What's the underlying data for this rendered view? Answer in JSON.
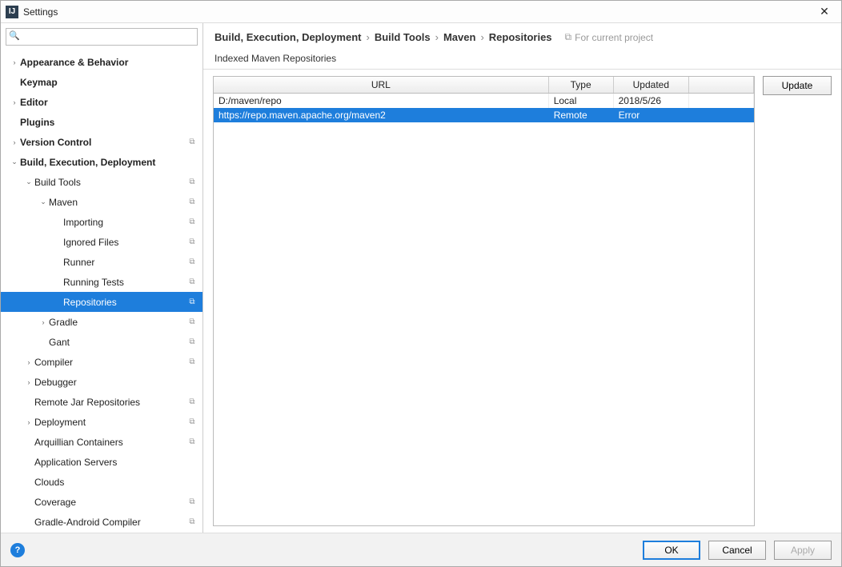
{
  "window": {
    "title": "Settings"
  },
  "breadcrumb": {
    "items": [
      "Build, Execution, Deployment",
      "Build Tools",
      "Maven",
      "Repositories"
    ],
    "hint": "For current project"
  },
  "section_label": "Indexed Maven Repositories",
  "table": {
    "headers": {
      "url": "URL",
      "type": "Type",
      "updated": "Updated",
      "extra": ""
    },
    "rows": [
      {
        "url": "D:/maven/repo",
        "type": "Local",
        "updated": "2018/5/26",
        "selected": false
      },
      {
        "url": "https://repo.maven.apache.org/maven2",
        "type": "Remote",
        "updated": "Error",
        "selected": true
      }
    ]
  },
  "buttons": {
    "update": "Update",
    "ok": "OK",
    "cancel": "Cancel",
    "apply": "Apply"
  },
  "tree": [
    {
      "label": "Appearance & Behavior",
      "indent": 0,
      "arrow": ">",
      "bold": true
    },
    {
      "label": "Keymap",
      "indent": 0,
      "arrow": "",
      "bold": true
    },
    {
      "label": "Editor",
      "indent": 0,
      "arrow": ">",
      "bold": true
    },
    {
      "label": "Plugins",
      "indent": 0,
      "arrow": "",
      "bold": true
    },
    {
      "label": "Version Control",
      "indent": 0,
      "arrow": ">",
      "bold": true,
      "badge": true
    },
    {
      "label": "Build, Execution, Deployment",
      "indent": 0,
      "arrow": "v",
      "bold": true
    },
    {
      "label": "Build Tools",
      "indent": 1,
      "arrow": "v",
      "badge": true
    },
    {
      "label": "Maven",
      "indent": 2,
      "arrow": "v",
      "badge": true
    },
    {
      "label": "Importing",
      "indent": 3,
      "arrow": "",
      "badge": true
    },
    {
      "label": "Ignored Files",
      "indent": 3,
      "arrow": "",
      "badge": true
    },
    {
      "label": "Runner",
      "indent": 3,
      "arrow": "",
      "badge": true
    },
    {
      "label": "Running Tests",
      "indent": 3,
      "arrow": "",
      "badge": true
    },
    {
      "label": "Repositories",
      "indent": 3,
      "arrow": "",
      "badge": true,
      "selected": true
    },
    {
      "label": "Gradle",
      "indent": 2,
      "arrow": ">",
      "badge": true
    },
    {
      "label": "Gant",
      "indent": 2,
      "arrow": "",
      "badge": true
    },
    {
      "label": "Compiler",
      "indent": 1,
      "arrow": ">",
      "badge": true
    },
    {
      "label": "Debugger",
      "indent": 1,
      "arrow": ">"
    },
    {
      "label": "Remote Jar Repositories",
      "indent": 1,
      "arrow": "",
      "badge": true
    },
    {
      "label": "Deployment",
      "indent": 1,
      "arrow": ">",
      "badge": true
    },
    {
      "label": "Arquillian Containers",
      "indent": 1,
      "arrow": "",
      "badge": true
    },
    {
      "label": "Application Servers",
      "indent": 1,
      "arrow": ""
    },
    {
      "label": "Clouds",
      "indent": 1,
      "arrow": ""
    },
    {
      "label": "Coverage",
      "indent": 1,
      "arrow": "",
      "badge": true
    },
    {
      "label": "Gradle-Android Compiler",
      "indent": 1,
      "arrow": "",
      "badge": true
    }
  ]
}
